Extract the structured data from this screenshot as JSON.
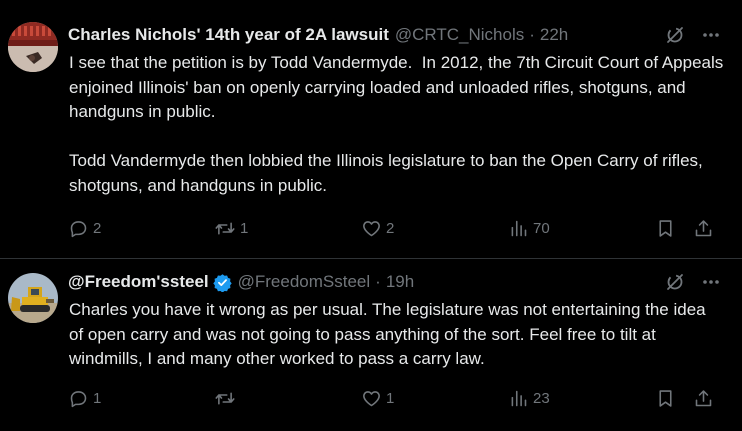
{
  "tweets": [
    {
      "display_name": "Charles Nichols' 14th year of 2A lawsuit",
      "handle": "@CRTC_Nichols",
      "separator": "·",
      "time": "22h",
      "verified": false,
      "avatar_icon": "avatar-photo-icon",
      "text": "I see that the petition is by Todd Vandermyde.  In 2012, the 7th Circuit Court of Appeals enjoined Illinois' ban on openly carrying loaded and unloaded rifles, shotguns, and handguns in public.\n\nTodd Vandermyde then lobbied the Illinois legislature to ban the Open Carry of rifles, shotguns, and handguns in public.",
      "replies": "2",
      "retweets": "1",
      "likes": "2",
      "views": "70"
    },
    {
      "display_name": "@Freedom'ssteel",
      "handle": "@FreedomSsteel",
      "separator": "·",
      "time": "19h",
      "verified": true,
      "avatar_icon": "avatar-bulldozer-icon",
      "text": "Charles you have it wrong as per usual. The legislature was not entertaining the idea of open carry and was not going to pass anything of the sort. Feel free to tilt at windmills, I and many other worked to pass a carry law.",
      "replies": "1",
      "retweets": "",
      "likes": "1",
      "views": "23"
    }
  ],
  "colors": {
    "background": "#000000",
    "text": "#e7e9ea",
    "muted": "#71767b",
    "divider": "#2f3336",
    "verified": "#1d9bf0"
  }
}
